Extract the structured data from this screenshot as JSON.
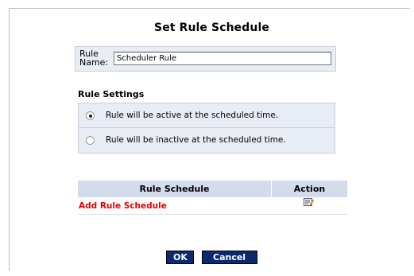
{
  "page": {
    "title": "Set Rule Schedule"
  },
  "rule_name": {
    "label_line1": "Rule",
    "label_line2": "Name:",
    "value": "Scheduler Rule"
  },
  "rule_settings": {
    "heading": "Rule Settings",
    "options": [
      {
        "label": "Rule will be active at the scheduled time.",
        "selected": true
      },
      {
        "label": "Rule will be inactive at the scheduled time.",
        "selected": false
      }
    ]
  },
  "schedule_table": {
    "headers": [
      "Rule Schedule",
      "Action"
    ],
    "add_link": "Add Rule Schedule",
    "action_icon": "edit-icon"
  },
  "buttons": {
    "ok": "OK",
    "cancel": "Cancel"
  },
  "colors": {
    "panel": "#e8ecf4",
    "table_header": "#d4dcec",
    "link_red": "#e00000",
    "button_navy": "#0b2a6e"
  }
}
